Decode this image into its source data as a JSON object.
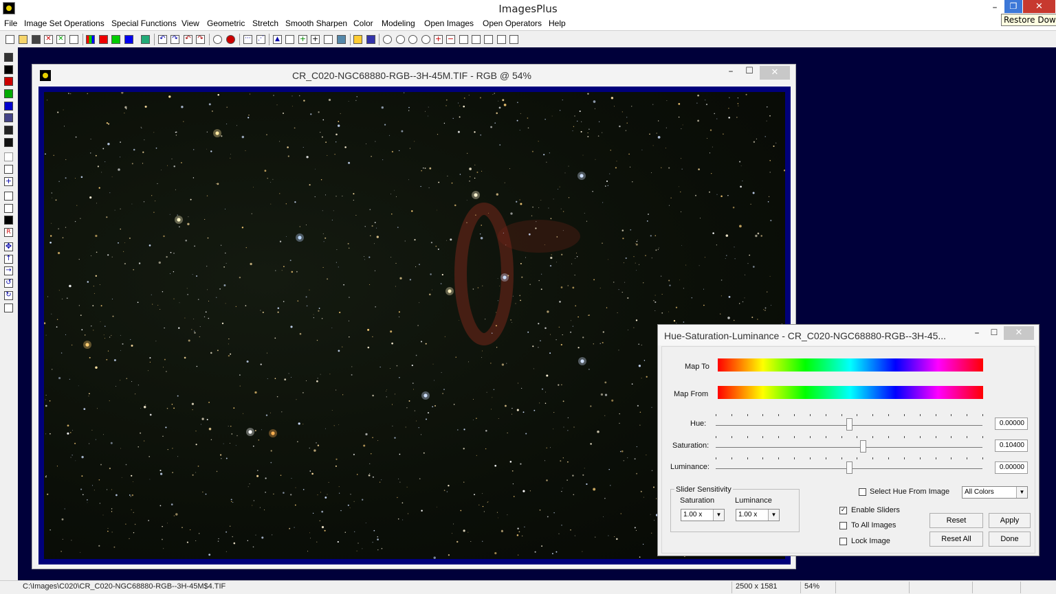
{
  "app": {
    "title": "ImagesPlus",
    "tooltip": "Restore Down"
  },
  "window_controls": {
    "minimize": "–",
    "restore": "❐",
    "close": "✕"
  },
  "menu": [
    {
      "label": "File"
    },
    {
      "label": "Image Set Operations"
    },
    {
      "label": "Special Functions"
    },
    {
      "label": "View"
    },
    {
      "label": "Geometric"
    },
    {
      "label": "Stretch"
    },
    {
      "label": "Smooth Sharpen"
    },
    {
      "label": "Color"
    },
    {
      "label": "Modeling"
    },
    {
      "label": "Open Images"
    },
    {
      "label": "Open Operators"
    },
    {
      "label": "Help"
    }
  ],
  "image_window": {
    "title": "CR_C020-NGC68880-RGB--3H-45M.TIF - RGB @ 54%",
    "minimize": "–",
    "maximize": "☐",
    "close": "✕"
  },
  "hsl_dialog": {
    "title": "Hue-Saturation-Luminance - CR_C020-NGC68880-RGB--3H-45...",
    "minimize": "–",
    "maximize": "☐",
    "close": "✕",
    "map_to_label": "Map To",
    "map_from_label": "Map From",
    "hue": {
      "label": "Hue:",
      "value": "0.00000",
      "position": 0.5
    },
    "saturation": {
      "label": "Saturation:",
      "value": "0.10400",
      "position": 0.552
    },
    "luminance": {
      "label": "Luminance:",
      "value": "0.00000",
      "position": 0.5
    },
    "sensitivity": {
      "title": "Slider Sensitivity",
      "saturation_label": "Saturation",
      "luminance_label": "Luminance",
      "saturation_value": "1.00 x",
      "luminance_value": "1.00 x"
    },
    "select_hue_from_image": {
      "label": "Select Hue From Image",
      "checked": false
    },
    "color_filter": "All Colors",
    "enable_sliders": {
      "label": "Enable Sliders",
      "checked": true
    },
    "to_all_images": {
      "label": "To All Images",
      "checked": false
    },
    "lock_image": {
      "label": "Lock Image",
      "checked": false
    },
    "buttons": {
      "reset": "Reset",
      "apply": "Apply",
      "reset_all": "Reset All",
      "done": "Done"
    }
  },
  "status": {
    "path": "C:\\Images\\C020\\CR_C020-NGC68880-RGB--3H-45M$4.TIF",
    "dimensions": "2500 x 1581",
    "zoom": "54%"
  },
  "colors": {
    "workspace": "#00003a",
    "image_frame": "#00007a",
    "restore_button": "#3c78d8",
    "close_button": "#c7392f"
  }
}
